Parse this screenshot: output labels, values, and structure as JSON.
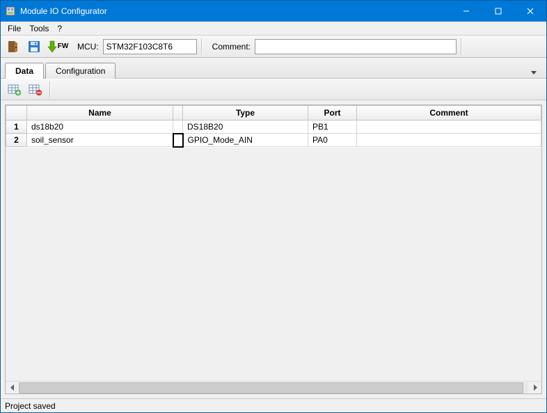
{
  "window": {
    "title": "Module IO Configurator"
  },
  "menu": {
    "file": "File",
    "tools": "Tools",
    "help": "?"
  },
  "toolbar": {
    "mcu_label": "MCU:",
    "mcu_value": "STM32F103C8T6",
    "comment_label": "Comment:",
    "comment_value": "",
    "fw_text": "FW"
  },
  "tabs": {
    "data": "Data",
    "config": "Configuration"
  },
  "grid": {
    "headers": {
      "name": "Name",
      "type": "Type",
      "port": "Port",
      "comment": "Comment"
    },
    "rows": [
      {
        "num": "1",
        "name": "ds18b20",
        "type": "DS18B20",
        "port": "PB1",
        "comment": ""
      },
      {
        "num": "2",
        "name": "soil_sensor",
        "type": "GPIO_Mode_AIN",
        "port": "PA0",
        "comment": ""
      }
    ]
  },
  "status": {
    "text": "Project saved"
  }
}
